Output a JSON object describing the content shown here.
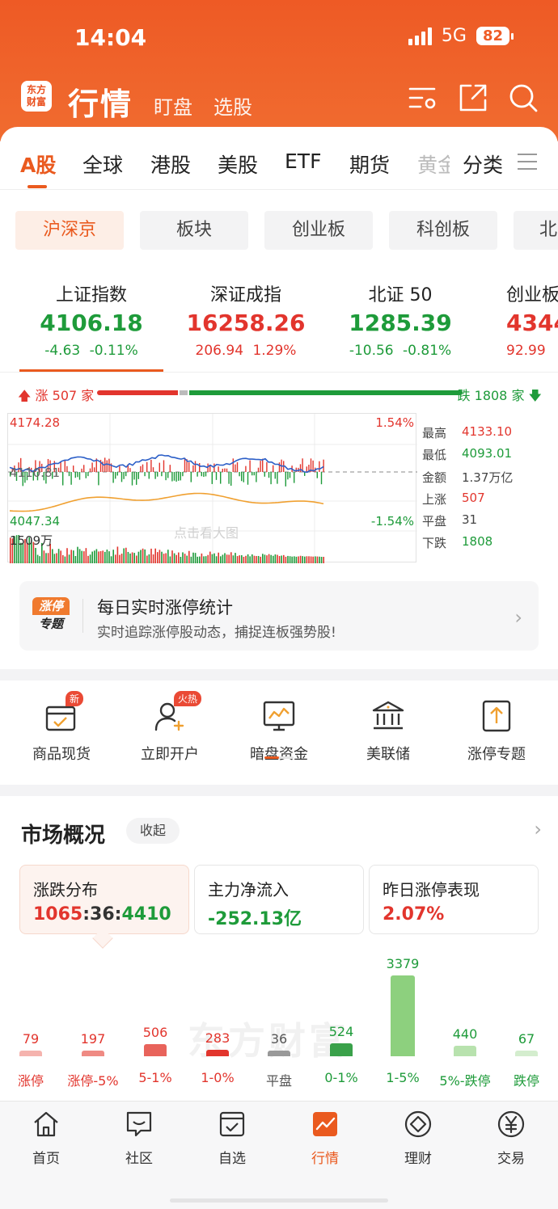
{
  "status": {
    "time": "14:04",
    "network": "5G",
    "battery": "82"
  },
  "header": {
    "logo_line1": "东方",
    "logo_line2": "财富",
    "title": "行情",
    "subtabs": [
      "盯盘",
      "选股"
    ]
  },
  "tabs": [
    "A股",
    "全球",
    "港股",
    "美股",
    "ETF",
    "期货",
    "黄金",
    "分类"
  ],
  "chips": [
    "沪深京",
    "板块",
    "创业板",
    "科创板",
    "北"
  ],
  "indices": [
    {
      "name": "上证指数",
      "value": "4106.18",
      "change": "-4.63",
      "pct": "-0.11%"
    },
    {
      "name": "深证成指",
      "value": "16258.26",
      "change": "206.94",
      "pct": "1.29%"
    },
    {
      "name": "北证 50",
      "value": "1285.39",
      "change": "-10.56",
      "pct": "-0.81%"
    },
    {
      "name": "创业板",
      "value": "4344",
      "change": "92.99",
      "pct": ""
    }
  ],
  "breadth": {
    "up_label": "涨 507 家",
    "down_label": "跌 1808 家",
    "up": 507,
    "flat": 31,
    "down": 1808
  },
  "intraday": {
    "high_label": "4174.28",
    "mid_label": "4110.81",
    "low_label": "4047.34",
    "pct_high": "1.54%",
    "pct_low": "-1.54%",
    "volume_label": "1509万",
    "watermark": "点击看大图"
  },
  "stats": [
    {
      "k": "最高",
      "v": "4133.10",
      "color": "#e2352d"
    },
    {
      "k": "最低",
      "v": "4093.01",
      "color": "#1e9b3a"
    },
    {
      "k": "金额",
      "v": "1.37万亿",
      "color": "#444444"
    },
    {
      "k": "上涨",
      "v": "507",
      "color": "#e2352d"
    },
    {
      "k": "平盘",
      "v": "31",
      "color": "#444444"
    },
    {
      "k": "下跌",
      "v": "1808",
      "color": "#1e9b3a"
    }
  ],
  "promo": {
    "badge_line1": "涨停",
    "badge_line2": "专题",
    "title": "每日实时涨停统计",
    "subtitle": "实时追踪涨停股动态，捕捉连板强势股!"
  },
  "quick": [
    {
      "label": "商品现货",
      "badge": "新",
      "icon": "cart-icon"
    },
    {
      "label": "立即开户",
      "badge": "火热",
      "icon": "user-add-icon"
    },
    {
      "label": "暗盘资金",
      "badge": "",
      "icon": "monitor-chart-icon"
    },
    {
      "label": "美联储",
      "badge": "",
      "icon": "bank-icon"
    },
    {
      "label": "涨停专题",
      "badge": "",
      "icon": "upload-icon"
    }
  ],
  "market": {
    "title": "市场概况",
    "collapse": "收起",
    "cards": [
      {
        "k": "涨跌分布",
        "v1": "1065",
        "v2": "36",
        "v3": "4410"
      },
      {
        "k": "主力净流入",
        "v": "-252.13亿"
      },
      {
        "k": "昨日涨停表现",
        "v": "2.07%"
      }
    ],
    "watermark": "东方财富"
  },
  "chart_data": {
    "type": "bar",
    "categories": [
      "涨停",
      "涨停-5%",
      "5-1%",
      "1-0%",
      "平盘",
      "0-1%",
      "1-5%",
      "5%-跌停",
      "跌停"
    ],
    "values": [
      79,
      197,
      506,
      283,
      36,
      524,
      3379,
      440,
      67
    ],
    "colors": [
      "#f5b3ae",
      "#ef8a83",
      "#e8635b",
      "#e2352d",
      "#999999",
      "#3aa14a",
      "#8dd07e",
      "#b8e2ae",
      "#d4edce"
    ],
    "label_colors": [
      "#e2352d",
      "#e2352d",
      "#e2352d",
      "#e2352d",
      "#555555",
      "#1e9b3a",
      "#1e9b3a",
      "#1e9b3a",
      "#1e9b3a"
    ]
  },
  "bottomnav": [
    {
      "label": "首页",
      "icon": "home-icon"
    },
    {
      "label": "社区",
      "icon": "chat-icon"
    },
    {
      "label": "自选",
      "icon": "checklist-icon"
    },
    {
      "label": "行情",
      "icon": "market-chart-icon"
    },
    {
      "label": "理财",
      "icon": "diamond-icon"
    },
    {
      "label": "交易",
      "icon": "yuan-icon"
    }
  ]
}
